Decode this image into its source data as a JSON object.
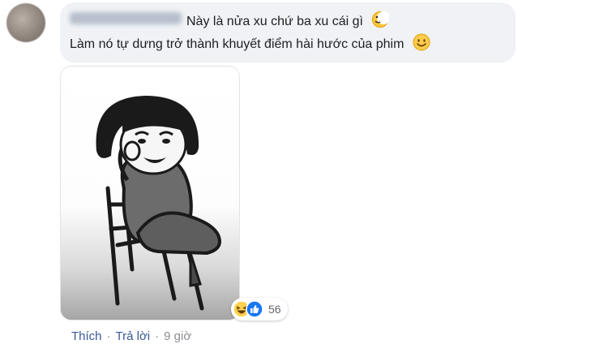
{
  "comment": {
    "line1": "Này là nửa xu chứ ba xu cái gì",
    "line2": "Làm nó tự dưng trở thành khuyết điểm hài hước của phim",
    "reactions": {
      "count": "56",
      "types": [
        "haha-icon",
        "like-icon"
      ]
    },
    "actions": {
      "like": "Thích",
      "reply": "Trả lời",
      "time": "9 giờ",
      "separator": "·"
    }
  },
  "colors": {
    "bubble": "#f0f2f5",
    "link": "#385898",
    "muted": "#8a8d91",
    "text": "#1c1e21"
  }
}
